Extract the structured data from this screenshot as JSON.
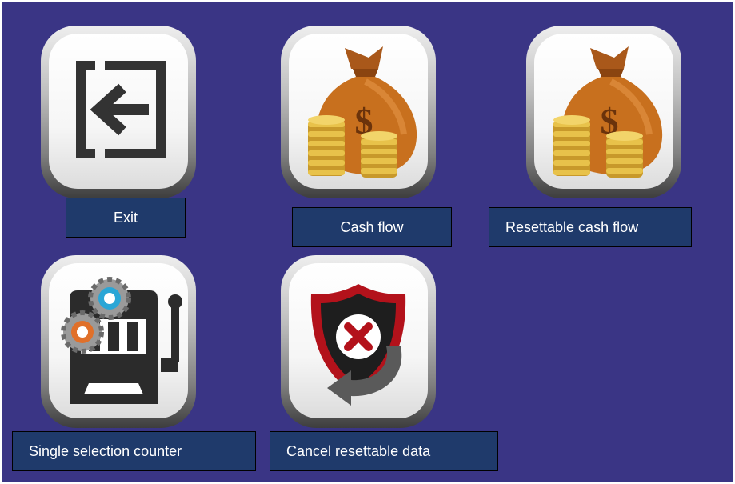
{
  "colors": {
    "background": "#3a3585",
    "label_bg": "#1f3a6b",
    "label_text": "#ffffff",
    "bag": "#c8701e",
    "coin": "#d9b23a",
    "shield_red": "#b3121b",
    "gear_orange": "#e0702a",
    "gear_cyan": "#2aa6d6"
  },
  "menu": [
    {
      "id": "exit",
      "label": "Exit",
      "icon": "exit-door-arrow-icon"
    },
    {
      "id": "cash-flow",
      "label": "Cash flow",
      "icon": "money-bag-coins-icon"
    },
    {
      "id": "resettable-cash-flow",
      "label": "Resettable cash flow",
      "icon": "money-bag-coins-icon"
    },
    {
      "id": "single-selection-counter",
      "label": "Single selection counter",
      "icon": "slot-machine-gears-icon"
    },
    {
      "id": "cancel-resettable-data",
      "label": "Cancel resettable data",
      "icon": "shield-x-arrow-icon"
    }
  ]
}
